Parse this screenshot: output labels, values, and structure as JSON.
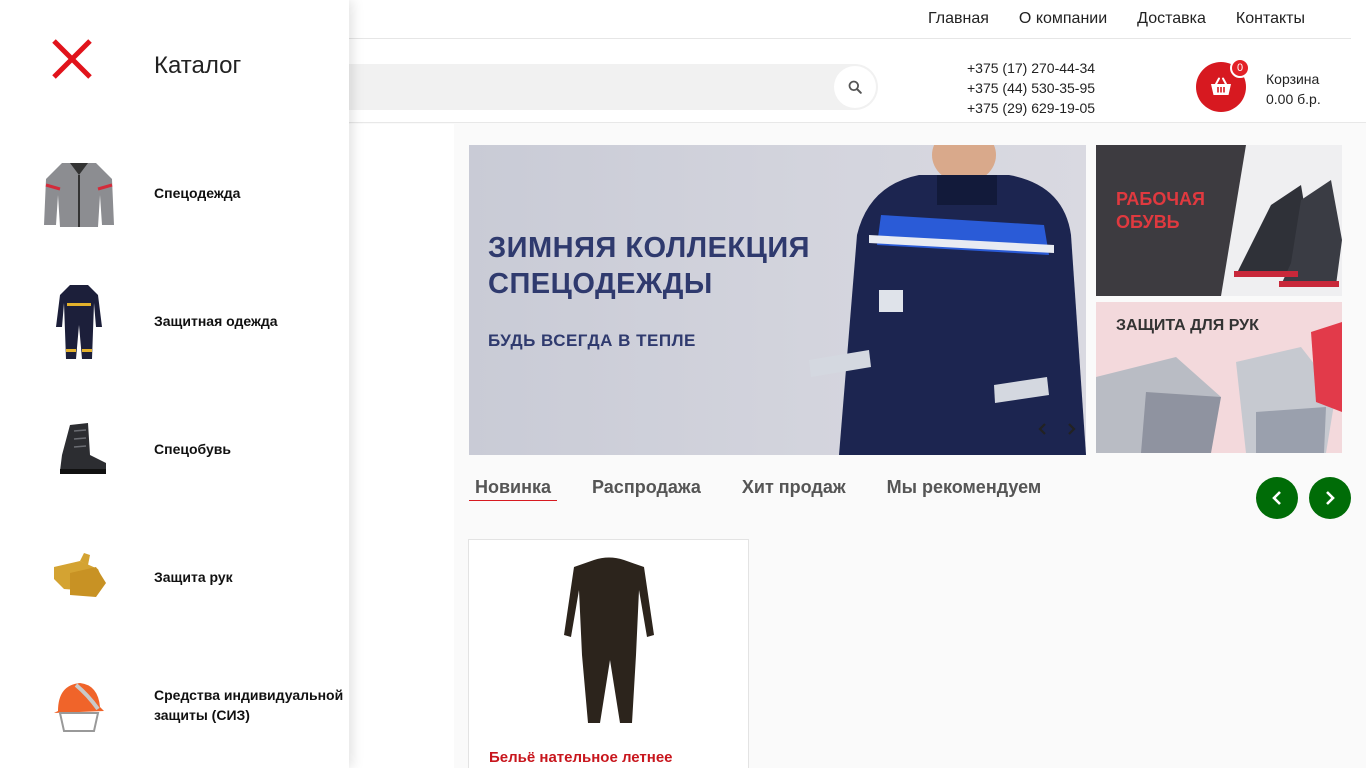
{
  "nav": {
    "links": [
      "Главная",
      "О компании",
      "Доставка",
      "Контакты"
    ]
  },
  "header": {
    "phones": [
      "+375 (17) 270-44-34",
      "+375 (44) 530-35-95",
      "+375 (29) 629-19-05"
    ],
    "cart_count": "0",
    "cart_label": "Корзина",
    "cart_total": "0.00 б.р."
  },
  "drawer": {
    "title": "Каталог",
    "items": [
      {
        "label": "Спецодежда",
        "icon": "jacket-icon"
      },
      {
        "label": "Защитная одежда",
        "icon": "coverall-icon"
      },
      {
        "label": "Спецобувь",
        "icon": "boot-icon"
      },
      {
        "label": "Защита рук",
        "icon": "gloves-icon"
      },
      {
        "label": "Средства индивидуальной защиты (СИЗ)",
        "icon": "helmet-icon"
      }
    ]
  },
  "banner": {
    "title_line1": "ЗИМНЯЯ КОЛЛЕКЦИЯ",
    "title_line2": "СПЕЦОДЕЖДЫ",
    "subtitle": "БУДЬ ВСЕГДА В ТЕПЛЕ"
  },
  "side_banners": {
    "top_line1": "РАБОЧАЯ",
    "top_line2": "ОБУВЬ",
    "bottom": "ЗАЩИТА ДЛЯ РУК"
  },
  "tabs": [
    "Новинка",
    "Распродажа",
    "Хит продаж",
    "Мы рекомендуем"
  ],
  "product": {
    "name": "Бельё нательное летнее"
  },
  "colors": {
    "accent_red": "#d71920",
    "green": "#006c07",
    "banner_text": "#2f3a6e"
  }
}
